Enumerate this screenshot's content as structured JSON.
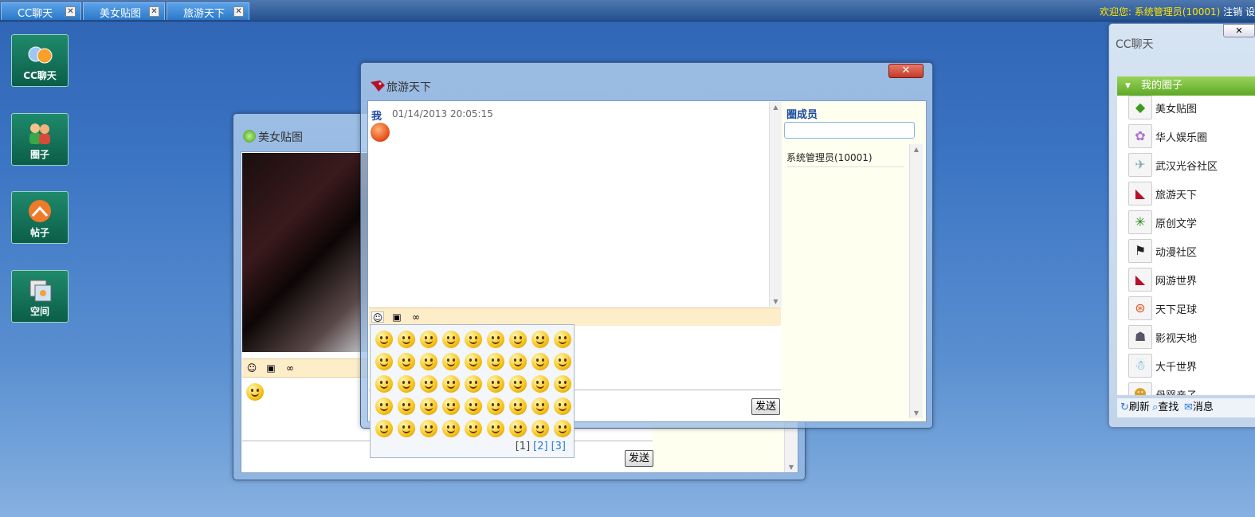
{
  "tabs": [
    {
      "label": "CC聊天"
    },
    {
      "label": "美女贴图"
    },
    {
      "label": "旅游天下"
    }
  ],
  "header": {
    "welcome_prefix": "欢迎您:",
    "user": "系统管理员(10001)",
    "logout": "注销",
    "settings_partial": "设"
  },
  "desktop_icons": [
    {
      "label": "CC聊天",
      "icon": "chat-icon"
    },
    {
      "label": "圈子",
      "icon": "people-icon"
    },
    {
      "label": "帖子",
      "icon": "post-icon"
    },
    {
      "label": "空间",
      "icon": "space-icon"
    }
  ],
  "window_meinv": {
    "title": "美女贴图",
    "send_label": "发送"
  },
  "window_lvyou": {
    "title": "旅游天下",
    "close_label": "x",
    "message_sender": "我",
    "message_time": "01/14/2013 20:05:15",
    "members_title": "圈成员",
    "member_search_value": "",
    "members": [
      "系统管理员(10001)"
    ],
    "send_label": "发送"
  },
  "emoji_picker": {
    "pages": [
      "[1]",
      "[2]",
      "[3]"
    ],
    "current_page": 1
  },
  "side_panel": {
    "title": "CC聊天",
    "close_label": "x",
    "section_title": "我的圈子",
    "groups": [
      {
        "name": "美女贴图"
      },
      {
        "name": "华人娱乐圈"
      },
      {
        "name": "武汉光谷社区"
      },
      {
        "name": "旅游天下"
      },
      {
        "name": "原创文学"
      },
      {
        "name": "动漫社区"
      },
      {
        "name": "网游世界"
      },
      {
        "name": "天下足球"
      },
      {
        "name": "影视天地"
      },
      {
        "name": "大千世界"
      },
      {
        "name": "母婴亲子"
      }
    ],
    "footer": {
      "refresh": "刷新",
      "search": "查找",
      "message": "消息"
    }
  }
}
